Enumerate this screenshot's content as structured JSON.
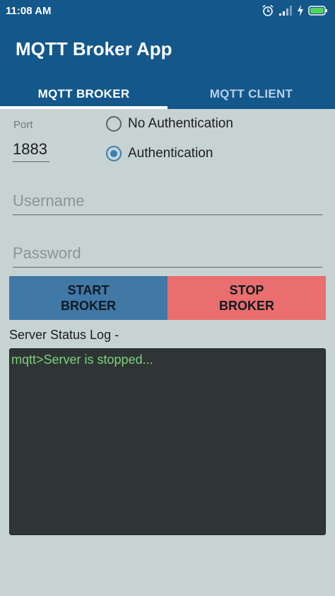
{
  "status_bar": {
    "time": "11:08 AM",
    "icons": [
      "alarm-icon",
      "signal-icon",
      "charging-icon",
      "battery-icon"
    ]
  },
  "app_bar": {
    "title": "MQTT Broker App"
  },
  "tabs": [
    {
      "label": "MQTT BROKER",
      "active": true
    },
    {
      "label": "MQTT CLIENT",
      "active": false
    }
  ],
  "form": {
    "port_label": "Port",
    "port_value": "1883",
    "auth_options": [
      {
        "label": "No Authentication",
        "checked": false
      },
      {
        "label": "Authentication",
        "checked": true
      }
    ],
    "username_placeholder": "Username",
    "password_placeholder": "Password"
  },
  "buttons": {
    "start_label": "START\nBROKER",
    "stop_label": "STOP\nBROKER"
  },
  "log": {
    "label": "Server Status Log -",
    "text": "mqtt>Server is stopped..."
  },
  "colors": {
    "primary": "#14578b",
    "start_button": "#4078a6",
    "stop_button": "#ea6e6e",
    "log_bg": "#2f3434",
    "log_text": "#7ed07e",
    "background": "#c7d3d3"
  }
}
